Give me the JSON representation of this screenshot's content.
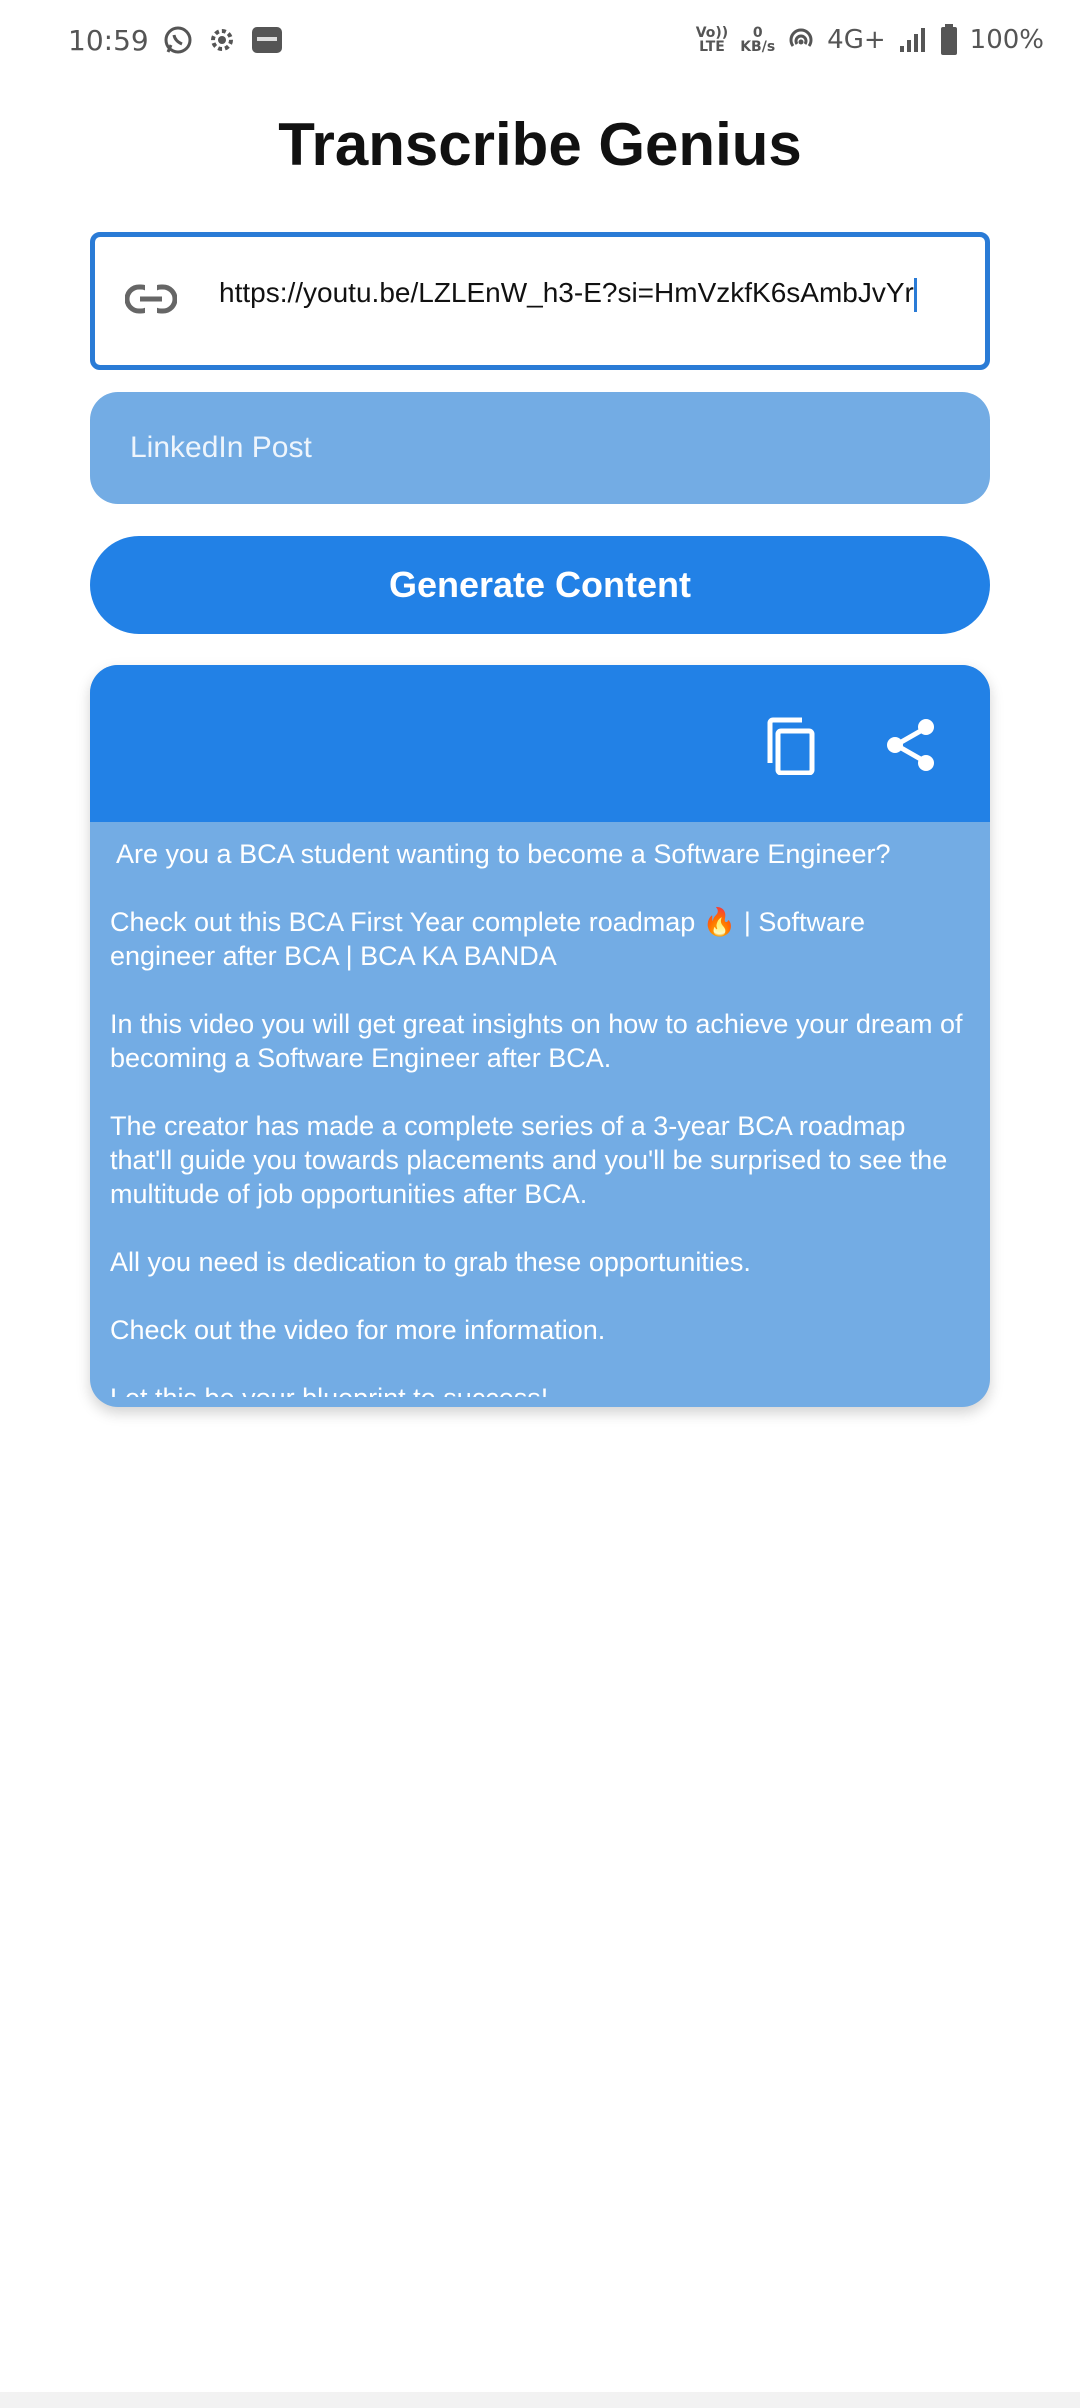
{
  "status_bar": {
    "time": "10:59",
    "volte_top": "Vo))",
    "volte_bottom": "LTE",
    "speed_top": "0",
    "speed_bottom": "KB/s",
    "network": "4G+",
    "battery": "100%"
  },
  "app": {
    "title": "Transcribe Genius"
  },
  "url_input": {
    "value": "https://youtu.be/LZLEnW_h3-E?si=HmVzkfK6sAmbJvYr"
  },
  "content_type": {
    "selected": "LinkedIn Post"
  },
  "generate_button": {
    "label": "Generate Content"
  },
  "result": {
    "paragraphs": [
      "Are you a BCA student wanting to become a Software Engineer?",
      "Check out this BCA First Year complete roadmap 🔥 | Software engineer after BCA  | BCA KA BANDA",
      "In this video you will get great insights on how to achieve your dream of becoming a Software Engineer after BCA.",
      "The creator has made a complete series of a 3-year BCA roadmap that'll guide you towards placements and you'll be surprised to see the multitude of job opportunities after BCA.",
      "All you need is dedication to grab these opportunities.",
      "Check out the video for more information.",
      "Let this be your blueprint to success!"
    ]
  },
  "colors": {
    "accent": "#2281e6",
    "light_accent": "#73ace4",
    "input_border": "#2a7bd6"
  },
  "icons": {
    "link": "link-icon",
    "copy": "copy-icon",
    "share": "share-icon"
  }
}
